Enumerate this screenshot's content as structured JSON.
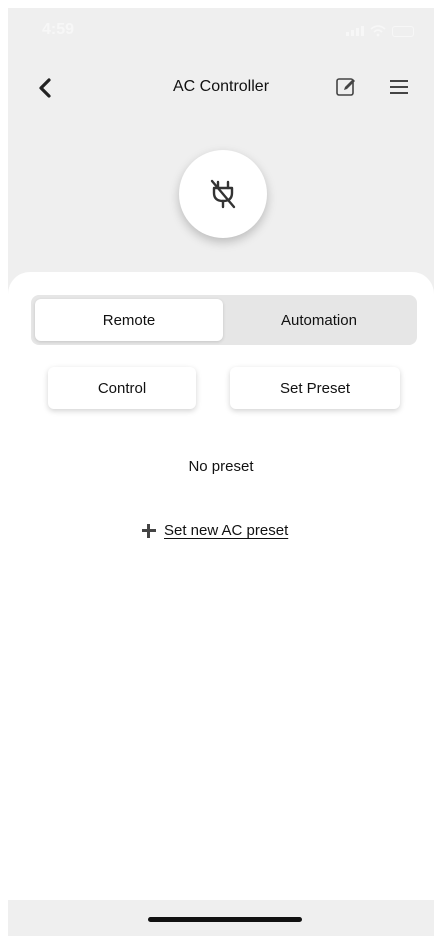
{
  "status_bar": {
    "time": "4:59"
  },
  "header": {
    "title": "AC Controller",
    "back_icon": "chevron-left-icon",
    "edit_icon": "edit-icon",
    "menu_icon": "hamburger-menu-icon"
  },
  "device": {
    "power_icon": "plug-off-icon"
  },
  "tabs": {
    "primary": [
      {
        "label": "Remote",
        "selected": true
      },
      {
        "label": "Automation",
        "selected": false
      }
    ],
    "secondary": [
      {
        "label": "Control",
        "selected": false
      },
      {
        "label": "Set Preset",
        "selected": true
      }
    ]
  },
  "content": {
    "empty_text": "No preset",
    "add_preset_label": "Set new AC preset"
  },
  "colors": {
    "background": "#efefef",
    "sheet": "#ffffff",
    "segment_bg": "#e6e6e6"
  }
}
